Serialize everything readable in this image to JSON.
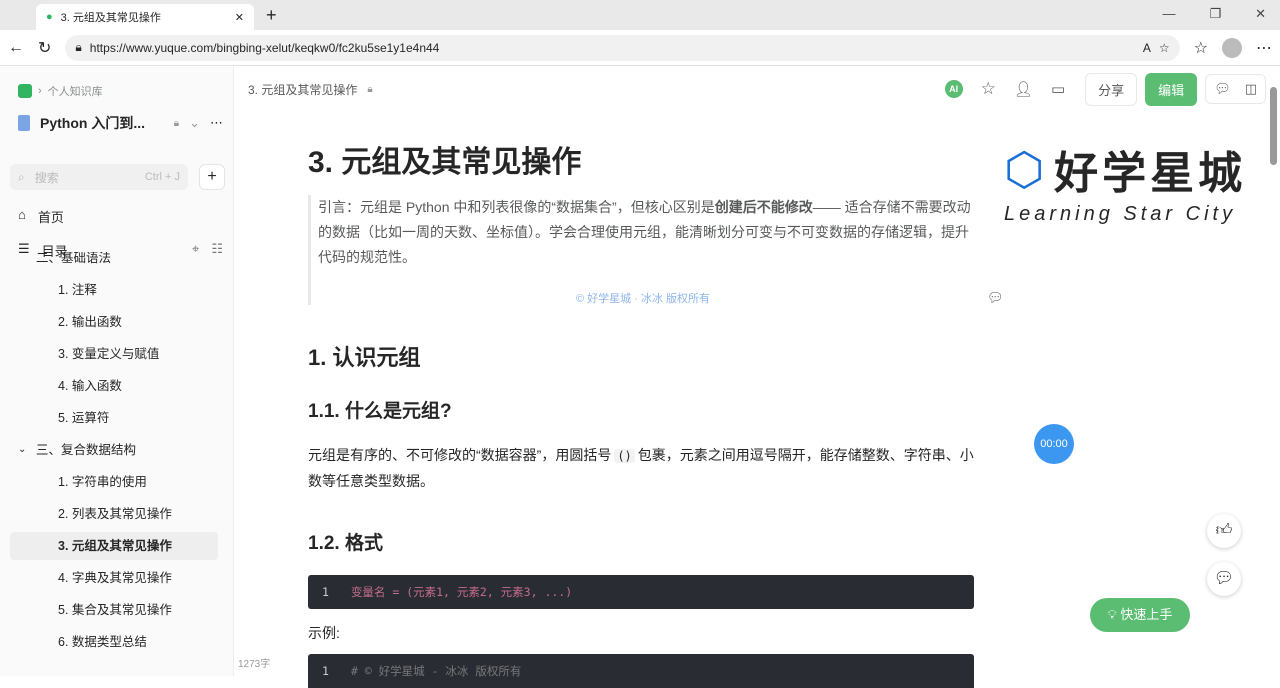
{
  "browser": {
    "tab_title": "3. 元组及其常见操作",
    "url": "https://www.yuque.com/bingbing-xelut/keqkw0/fc2ku5se1y1e4n44"
  },
  "sidebar": {
    "breadcrumb": "个人知识库",
    "book_title": "Python 入门到...",
    "search_placeholder": "搜索",
    "search_shortcut": "Ctrl + J",
    "home": "首页",
    "toc": "目录",
    "items": [
      {
        "label": "二、基础语法",
        "level": 0
      },
      {
        "label": "1. 注释",
        "level": 1
      },
      {
        "label": "2. 输出函数",
        "level": 1
      },
      {
        "label": "3. 变量定义与赋值",
        "level": 1
      },
      {
        "label": "4. 输入函数",
        "level": 1
      },
      {
        "label": "5. 运算符",
        "level": 1
      },
      {
        "label": "三、复合数据结构",
        "level": 0
      },
      {
        "label": "1. 字符串的使用",
        "level": 1
      },
      {
        "label": "2. 列表及其常见操作",
        "level": 1
      },
      {
        "label": "3. 元组及其常见操作",
        "level": 1,
        "active": true
      },
      {
        "label": "4. 字典及其常见操作",
        "level": 1
      },
      {
        "label": "5. 集合及其常见操作",
        "level": 1
      },
      {
        "label": "6. 数据类型总结",
        "level": 1
      }
    ],
    "word_count": "1273字"
  },
  "topbar": {
    "doc_title": "3. 元组及其常见操作",
    "ai": "AI",
    "share": "分享",
    "edit": "编辑"
  },
  "doc": {
    "title": "3. 元组及其常见操作",
    "quote_a": "引言：元组是 Python 中和列表很像的“数据集合”，但核心区别是",
    "quote_bold": "创建后不能修改",
    "quote_b": "—— 适合存储不需要改动的数据（比如一周的天数、坐标值）。学会合理使用元组，能清晰划分可变与不可变数据的存储逻辑，提升代码的规范性。",
    "watermark": "© 好学星城 · 冰冰 版权所有",
    "h2": "1. 认识元组",
    "h3a": "1.1. 什么是元组?",
    "p1a": "元组是有序的、不可修改的“数据容器”，用圆括号",
    "p1code": "()",
    "p1b": "包裹，元素之间用逗号隔开，能存储整数、字符串、小数等任意类型数据。",
    "h3b": "1.2. 格式",
    "code1_ln": "1",
    "code1": "变量名 = (元素1, 元素2, 元素3, ...)",
    "example": "示例:",
    "code2_ln": "1",
    "code2": "# © 好学星城 - 冰冰 版权所有"
  },
  "logo": {
    "cn": "好学星城",
    "en": "Learning Star City"
  },
  "timer": "00:00",
  "quickstart": "快速上手"
}
